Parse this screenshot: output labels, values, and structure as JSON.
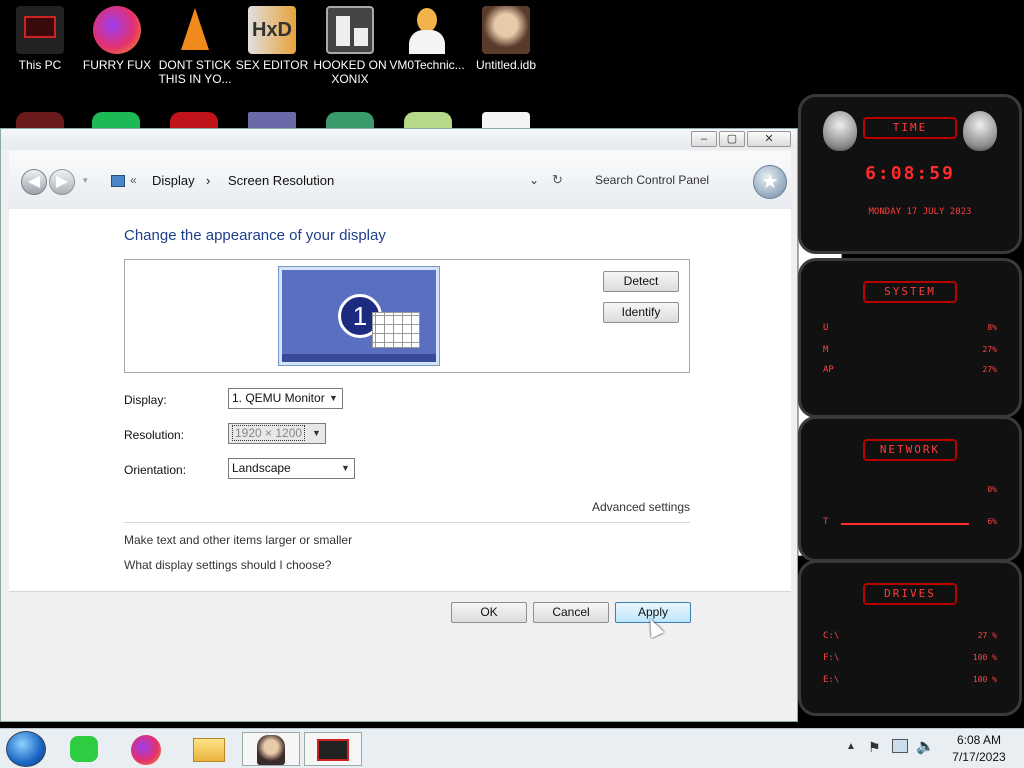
{
  "desktop": {
    "icons": [
      {
        "label": "This PC",
        "icon": "computer-icon"
      },
      {
        "label": "FURRY FUX",
        "icon": "firefox-icon"
      },
      {
        "label": "DONT STICK THIS IN YO...",
        "icon": "vlc-cone-icon"
      },
      {
        "label": "SEX EDITOR",
        "icon": "hex-editor-icon"
      },
      {
        "label": "HOOKED ON XONIX",
        "icon": "game-icon"
      },
      {
        "label": "VM0Technic...",
        "icon": "doctor-icon"
      },
      {
        "label": "Untitled.idb",
        "icon": "portrait-icon"
      }
    ]
  },
  "gadget": {
    "time_title": "TIME",
    "clock": "6:08:59",
    "date": "MONDAY 17 JULY 2023",
    "system_title": "SYSTEM",
    "system_rows": [
      {
        "label": "U",
        "value": "8%"
      },
      {
        "label": "M",
        "value": "27%"
      },
      {
        "label": "AP",
        "value": "27%"
      }
    ],
    "network_title": "NETWORK",
    "network_rows": [
      {
        "label": "",
        "value": "0%"
      },
      {
        "label": "T",
        "value": "6%"
      }
    ],
    "drives_title": "DRIVES",
    "drives_rows": [
      {
        "label": "C:\\",
        "value": "27 %"
      },
      {
        "label": "F:\\",
        "value": "100 %"
      },
      {
        "label": "E:\\",
        "value": "100 %"
      }
    ]
  },
  "window": {
    "breadcrumb": {
      "root": "Display",
      "current": "Screen Resolution"
    },
    "search_placeholder": "Search Control Panel",
    "heading": "Change the appearance of your display",
    "monitor_number": "1",
    "detect_label": "Detect",
    "identify_label": "Identify",
    "display_label": "Display:",
    "display_value": "1. QEMU Monitor",
    "resolution_label": "Resolution:",
    "resolution_value": "1920 × 1200",
    "orientation_label": "Orientation:",
    "orientation_value": "Landscape",
    "advanced_link": "Advanced settings",
    "link_text_size": "Make text and other items larger or smaller",
    "link_which_settings": "What display settings should I choose?",
    "ok_label": "OK",
    "cancel_label": "Cancel",
    "apply_label": "Apply"
  },
  "taskbar": {
    "time": "6:08 AM",
    "date": "7/17/2023"
  }
}
